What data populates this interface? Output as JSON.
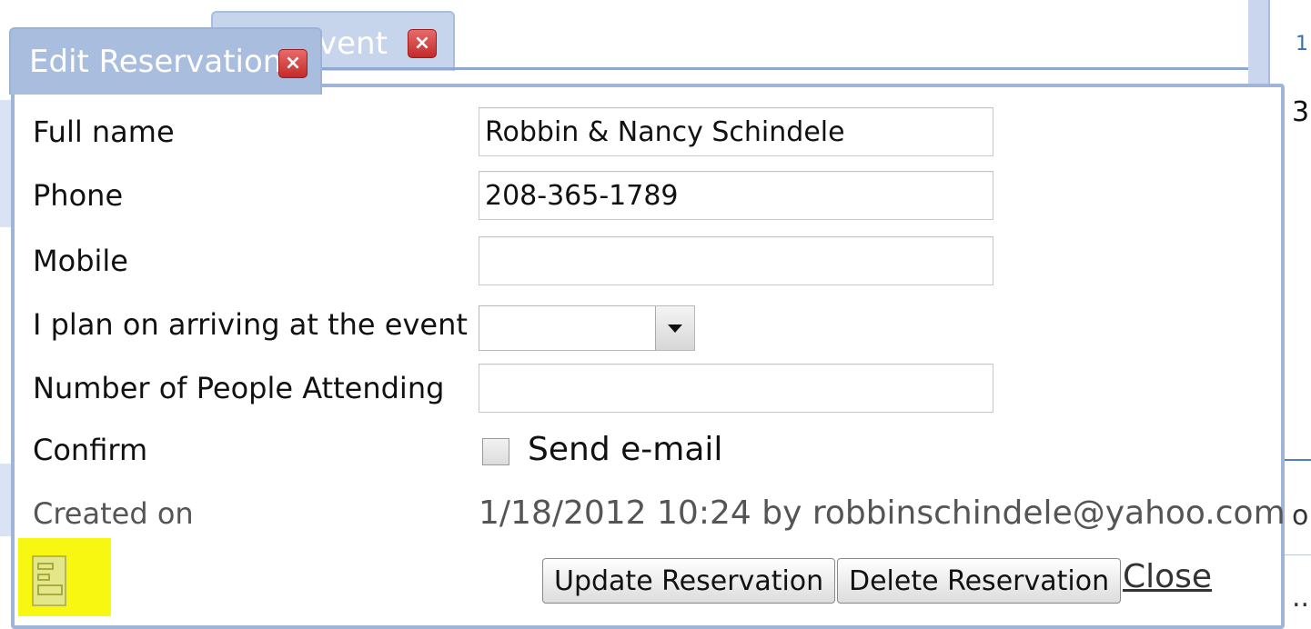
{
  "background": {
    "rail_number_top": "1",
    "rail_number_mid": "3",
    "rail_fragment_1": "o.",
    "rail_fragment_2": "..."
  },
  "tabs": {
    "back_tab_label": "vent",
    "front_tab_label": "Edit Reservation",
    "close_glyph": "×"
  },
  "form": {
    "full_name": {
      "label": "Full name",
      "value": "Robbin & Nancy Schindele"
    },
    "phone": {
      "label": "Phone",
      "value": "208-365-1789"
    },
    "mobile": {
      "label": "Mobile",
      "value": ""
    },
    "arriving": {
      "label": "I plan on arriving at the event",
      "selected": ""
    },
    "people": {
      "label": "Number of People Attending",
      "value": ""
    },
    "confirm": {
      "label": "Confirm",
      "checkbox_label": "Send e-mail",
      "checked": false
    },
    "created": {
      "label": "Created on",
      "value": "1/18/2012 10:24 by robbinschindele@yahoo.com"
    }
  },
  "actions": {
    "update_label": "Update Reservation",
    "delete_label": "Delete Reservation",
    "close_label": "Close"
  },
  "icons": {
    "tab_close": "close-icon",
    "dropdown": "chevron-down-icon",
    "form_toggle": "form-icon"
  },
  "colors": {
    "tab_blue": "#a9bedf",
    "close_red": "#d13b3b",
    "highlight_yellow": "#f7f711"
  }
}
